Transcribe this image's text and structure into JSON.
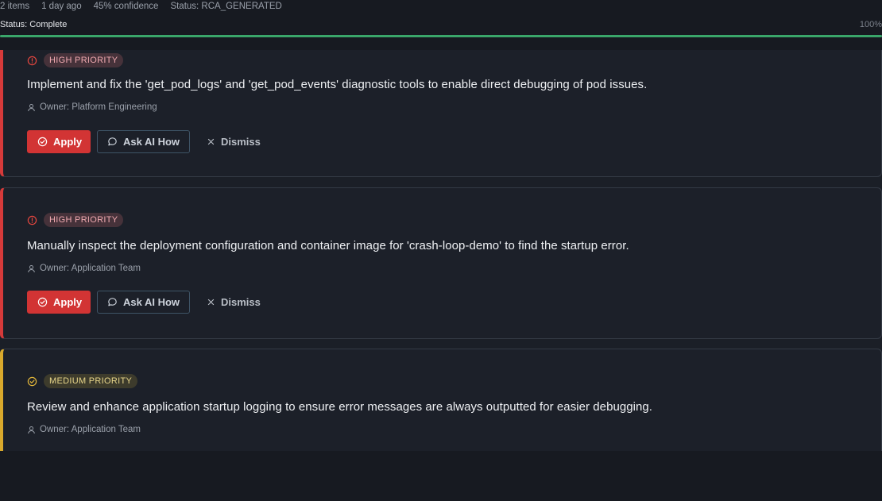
{
  "meta": {
    "items": "2 items",
    "time": "1 day ago",
    "confidence": "45% confidence",
    "status": "Status: RCA_GENERATED"
  },
  "progress": {
    "label": "Status: Complete",
    "percent_label": "100%",
    "value": 1.0,
    "color": "#3aa66a"
  },
  "recommendations": [
    {
      "priority": "HIGH PRIORITY",
      "priority_icon": "alert-circle-icon",
      "title": "Implement and fix the 'get_pod_logs' and 'get_pod_events' diagnostic tools to enable direct debugging of pod issues.",
      "owner": "Owner: Platform Engineering",
      "apply": "Apply",
      "ask": "Ask AI How",
      "dismiss": "Dismiss"
    },
    {
      "priority": "HIGH PRIORITY",
      "priority_icon": "alert-circle-icon",
      "title": "Manually inspect the deployment configuration and container image for 'crash-loop-demo' to find the startup error.",
      "owner": "Owner: Application Team",
      "apply": "Apply",
      "ask": "Ask AI How",
      "dismiss": "Dismiss"
    },
    {
      "priority": "MEDIUM PRIORITY",
      "priority_icon": "check-circle-icon",
      "title": "Review and enhance application startup logging to ensure error messages are always outputted for easier debugging.",
      "owner": "Owner: Application Team"
    }
  ],
  "colors": {
    "high": "#d63a3a",
    "medium": "#d9a92c",
    "apply_button": "#d23434"
  }
}
